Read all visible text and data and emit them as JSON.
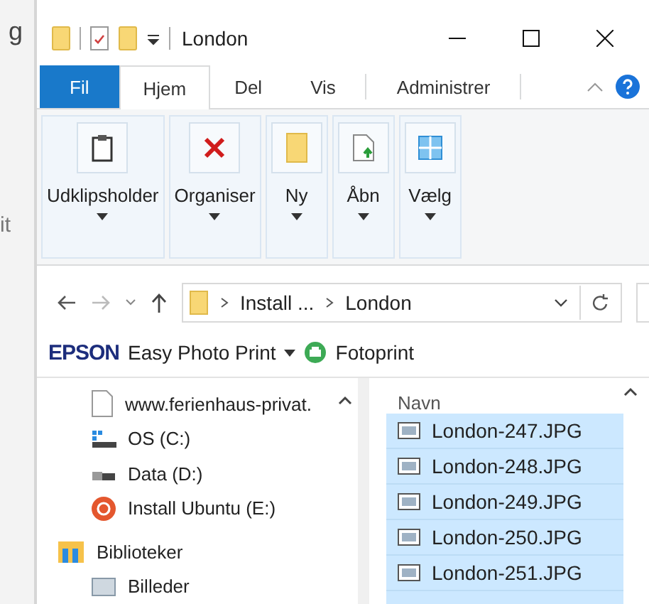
{
  "background_window": {
    "texts": [
      "g",
      "it"
    ]
  },
  "window": {
    "title": "London"
  },
  "tabs": [
    {
      "label": "Fil",
      "kind": "file",
      "selected": false
    },
    {
      "label": "Hjem",
      "kind": "tab",
      "selected": true
    },
    {
      "label": "Del",
      "kind": "tab",
      "selected": false
    },
    {
      "label": "Vis",
      "kind": "tab",
      "selected": false
    },
    {
      "label": "Administrer",
      "kind": "tab",
      "selected": false
    }
  ],
  "ribbon_groups": [
    {
      "label": "Udklipsholder",
      "kind": "clipboard"
    },
    {
      "label": "Organiser",
      "kind": "delete"
    },
    {
      "label": "Ny",
      "kind": "folder"
    },
    {
      "label": "Åbn",
      "kind": "open"
    },
    {
      "label": "Vælg",
      "kind": "select"
    }
  ],
  "address_bar": {
    "segments": [
      "Install ...",
      "London"
    ]
  },
  "epson_toolbar": {
    "brand": "EPSON",
    "menu": "Easy Photo Print",
    "button": "Fotoprint"
  },
  "navigation_pane": {
    "items": [
      {
        "label": "www.ferienhaus-privat.",
        "kind": "file"
      },
      {
        "label": "OS (C:)",
        "kind": "drive"
      },
      {
        "label": "Data (D:)",
        "kind": "drive2"
      },
      {
        "label": "Install Ubuntu (E:)",
        "kind": "ubuntu"
      },
      {
        "label": "Biblioteker",
        "kind": "library"
      },
      {
        "label": "Billeder",
        "kind": "pictures"
      }
    ]
  },
  "file_list": {
    "column": "Navn",
    "rows": [
      {
        "name": "London-247.JPG",
        "selected": true
      },
      {
        "name": "London-248.JPG",
        "selected": true
      },
      {
        "name": "London-249.JPG",
        "selected": true
      },
      {
        "name": "London-250.JPG",
        "selected": true
      },
      {
        "name": "London-251.JPG",
        "selected": true
      }
    ]
  }
}
